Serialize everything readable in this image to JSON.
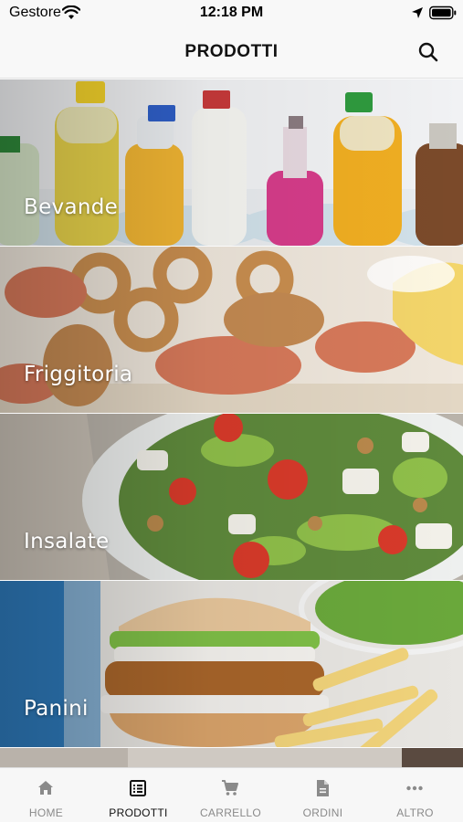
{
  "status": {
    "carrier": "Gestore",
    "time": "12:18 PM"
  },
  "header": {
    "title": "PRODOTTI",
    "search_icon": "search-icon"
  },
  "categories": [
    {
      "label": "Bevande",
      "image": "drinks-photo"
    },
    {
      "label": "Friggitoria",
      "image": "fried-seafood-photo"
    },
    {
      "label": "Insalate",
      "image": "salad-photo"
    },
    {
      "label": "Panini",
      "image": "burger-photo"
    }
  ],
  "tabs": [
    {
      "label": "HOME",
      "icon": "home-icon",
      "active": false
    },
    {
      "label": "PRODOTTI",
      "icon": "list-icon",
      "active": true
    },
    {
      "label": "CARRELLO",
      "icon": "cart-icon",
      "active": false
    },
    {
      "label": "ORDINI",
      "icon": "document-icon",
      "active": false
    },
    {
      "label": "ALTRO",
      "icon": "more-icon",
      "active": false
    }
  ],
  "colors": {
    "active_tab": "#111111",
    "inactive_tab": "#8a8a8a",
    "bar_background": "#f8f8f8"
  }
}
